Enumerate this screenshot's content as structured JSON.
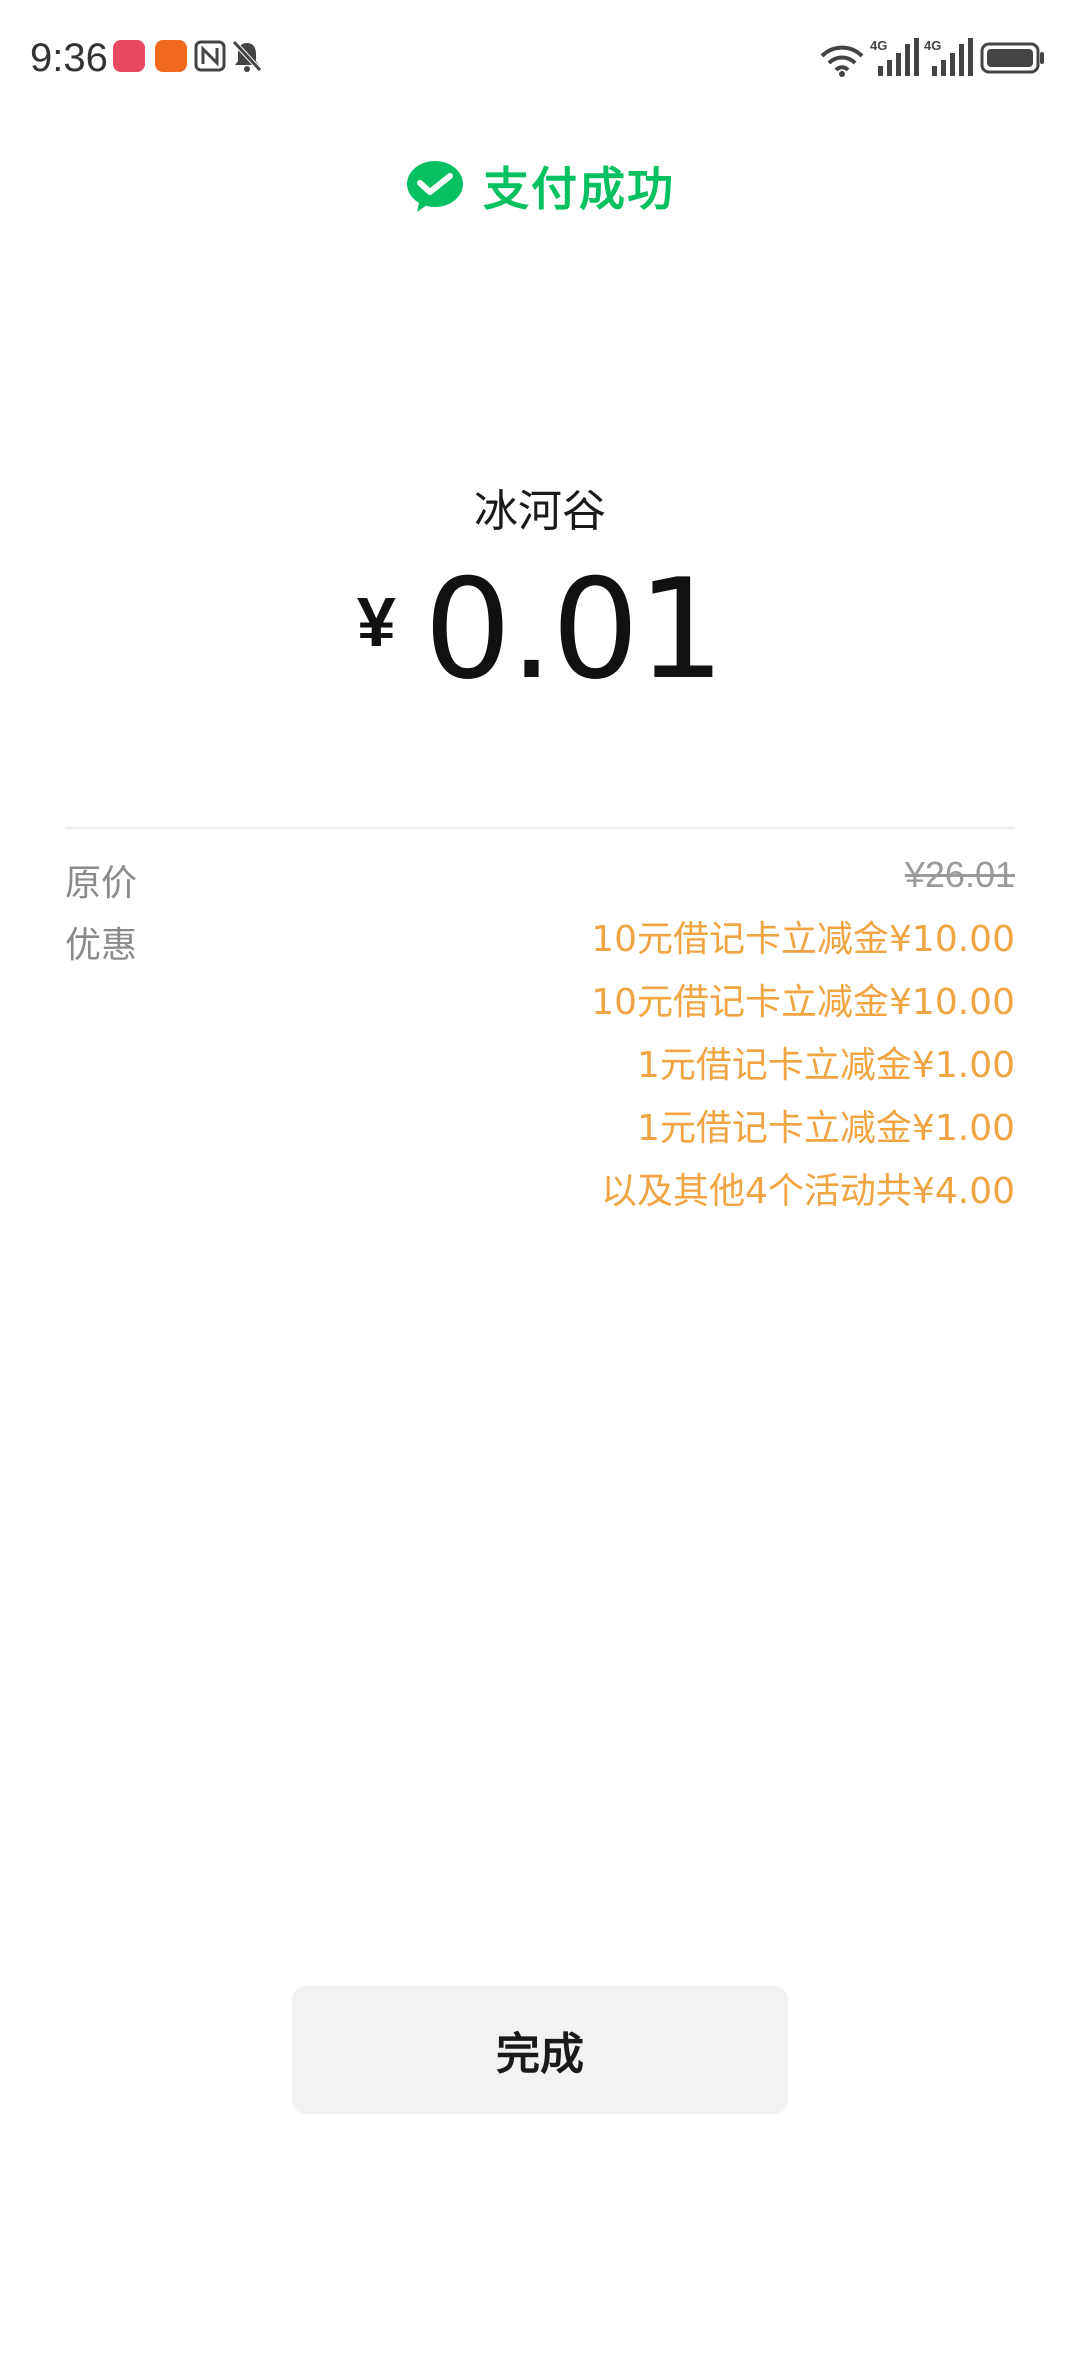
{
  "status_bar": {
    "time": "9:36",
    "network_labels": [
      "4G",
      "4G"
    ]
  },
  "header": {
    "title": "支付成功",
    "icon": "wechat-pay-icon",
    "accent_color": "#07c160"
  },
  "payment": {
    "merchant": "冰河谷",
    "currency_symbol": "¥",
    "amount": "0.01"
  },
  "details": {
    "original_price_label": "原价",
    "original_price": "¥26.01",
    "discount_label": "优惠",
    "discount_color": "#f0a442",
    "discounts": [
      "10元借记卡立减金¥10.00",
      "10元借记卡立减金¥10.00",
      "1元借记卡立减金¥1.00",
      "1元借记卡立减金¥1.00",
      "以及其他4个活动共¥4.00"
    ]
  },
  "actions": {
    "done_label": "完成"
  }
}
